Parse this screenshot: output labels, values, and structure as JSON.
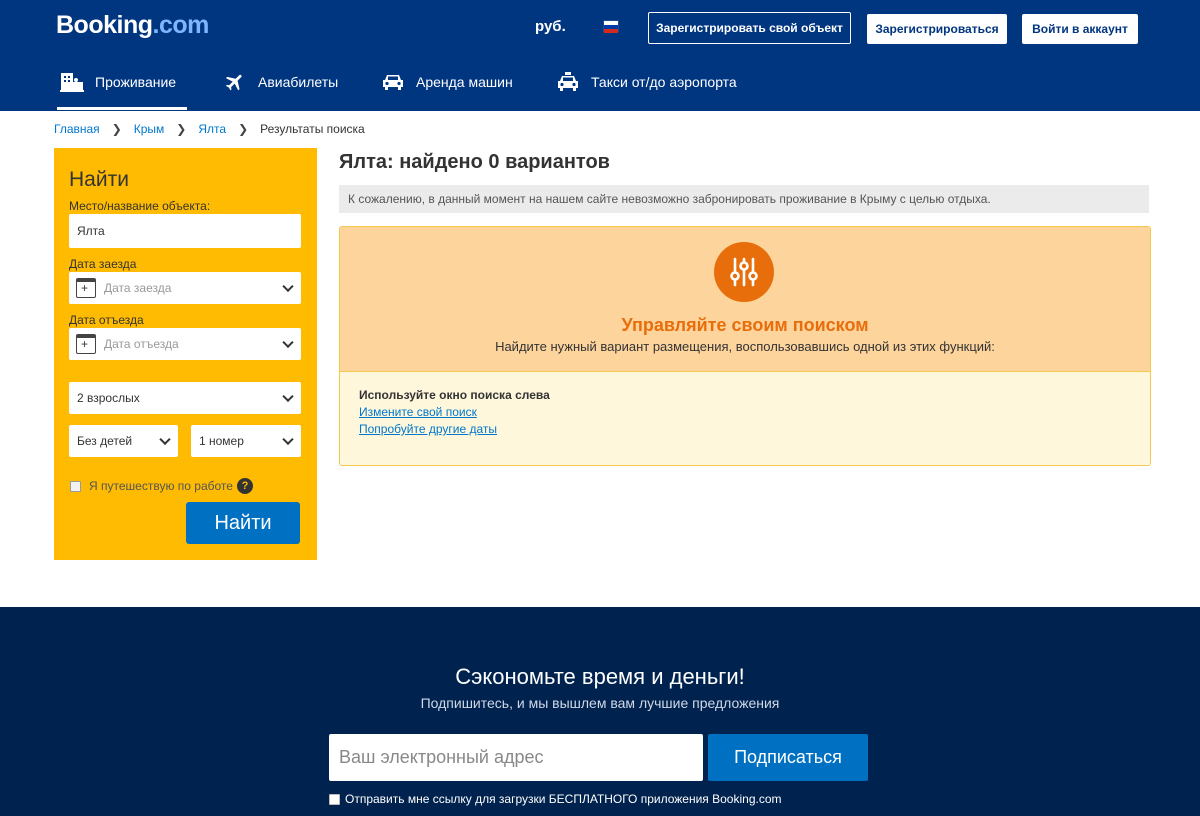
{
  "header": {
    "logo_main": "Booking",
    "logo_suffix": ".com",
    "currency": "руб.",
    "flag_icon": "russia-flag-icon",
    "list_property_label": "Зарегистрировать свой объект",
    "register_label": "Зарегистрироваться",
    "signin_label": "Войти в аккаунт",
    "nav": [
      {
        "label": "Проживание",
        "icon": "bed-icon"
      },
      {
        "label": "Авиабилеты",
        "icon": "plane-icon"
      },
      {
        "label": "Аренда машин",
        "icon": "car-icon"
      },
      {
        "label": "Такси от/до аэропорта",
        "icon": "taxi-icon"
      }
    ]
  },
  "breadcrumb": {
    "items": [
      "Главная",
      "Крым",
      "Ялта"
    ],
    "current": "Результаты поиска"
  },
  "search": {
    "title": "Найти",
    "destination_label": "Место/название объекта:",
    "destination_value": "Ялта",
    "checkin_label": "Дата заезда",
    "checkin_placeholder": "Дата заезда",
    "checkout_label": "Дата отъезда",
    "checkout_placeholder": "Дата отъезда",
    "adults": "2 взрослых",
    "children": "Без детей",
    "rooms": "1 номер",
    "business_label": "Я путешествую по работе",
    "help_symbol": "?",
    "submit_label": "Найти"
  },
  "results": {
    "title": "Ялта: найдено 0 вариантов",
    "notice": "К сожалению, в данный момент на нашем сайте невозможно забронировать проживание в Крыму с целью отдыха.",
    "promo_icon": "sliders-icon",
    "promo_title": "Управляйте своим поиском",
    "promo_subtitle": "Найдите нужный вариант размещения, воспользовавшись одной из этих функций:",
    "tips_heading": "Используйте окно поиска слева",
    "link_change": "Измените свой поиск",
    "link_dates": "Попробуйте другие даты"
  },
  "footer": {
    "title": "Сэкономьте время и деньги!",
    "subtitle": "Подпишитесь, и мы вышлем вам лучшие предложения",
    "email_placeholder": "Ваш электронный адрес",
    "subscribe_label": "Подписаться",
    "app_link_label": "Отправить мне ссылку для загрузки БЕСПЛАТНОГО приложения Booking.com"
  },
  "colors": {
    "brand_blue": "#003580",
    "yellow": "#febb02",
    "action_blue": "#0071c2",
    "orange": "#e86e0b"
  }
}
